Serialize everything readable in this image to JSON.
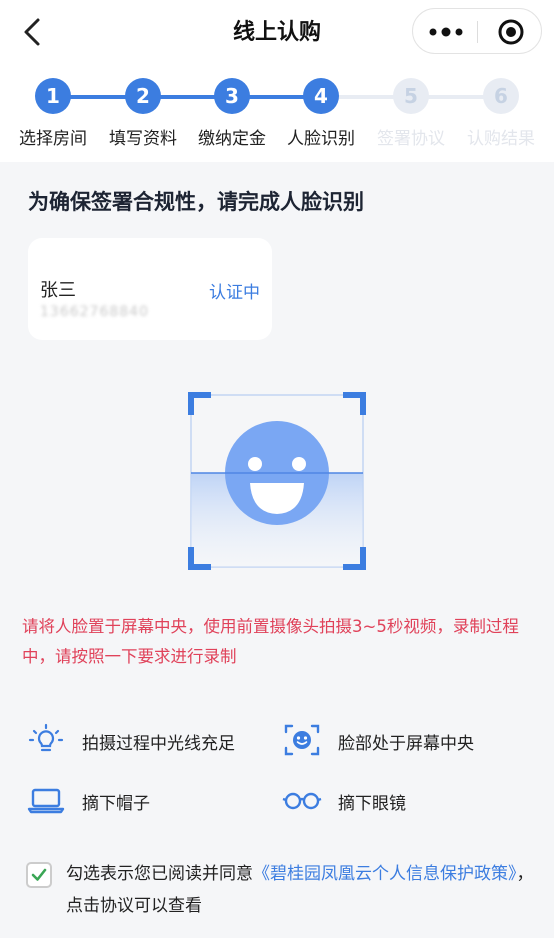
{
  "header": {
    "title": "线上认购",
    "back_icon": "chevron-left-icon",
    "more_icon": "more-dots-icon",
    "close_icon": "target-circle-icon"
  },
  "steps": [
    {
      "num": "1",
      "label": "选择房间",
      "state": "done"
    },
    {
      "num": "2",
      "label": "填写资料",
      "state": "done"
    },
    {
      "num": "3",
      "label": "缴纳定金",
      "state": "done"
    },
    {
      "num": "4",
      "label": "人脸识别",
      "state": "current"
    },
    {
      "num": "5",
      "label": "签署协议",
      "state": "pending"
    },
    {
      "num": "6",
      "label": "认购结果",
      "state": "pending"
    }
  ],
  "heading": "为确保签署合规性，请完成人脸识别",
  "user": {
    "name": "张三",
    "phone": "13662768840",
    "status": "认证中"
  },
  "instruction": "请将人脸置于屏幕中央，使用前置摄像头拍摄3~5秒视频，录制过程中，请按照一下要求进行录制",
  "tips": [
    {
      "icon": "light-bulb-icon",
      "text": "拍摄过程中光线充足"
    },
    {
      "icon": "face-frame-icon",
      "text": "脸部处于屏幕中央"
    },
    {
      "icon": "laptop-icon",
      "text": "摘下帽子"
    },
    {
      "icon": "glasses-icon",
      "text": "摘下眼镜"
    }
  ],
  "agreement": {
    "checked": true,
    "prefix": "勾选表示您已阅读并同意",
    "link": "《碧桂园凤凰云个人信息保护政策》",
    "suffix": "，点击协议可以查看"
  },
  "colors": {
    "accent": "#3c7de0",
    "step_done": "#3c7de0",
    "step_pending": "#e8ecf3",
    "warning": "#e0425a",
    "face": "#7aa7f3"
  }
}
